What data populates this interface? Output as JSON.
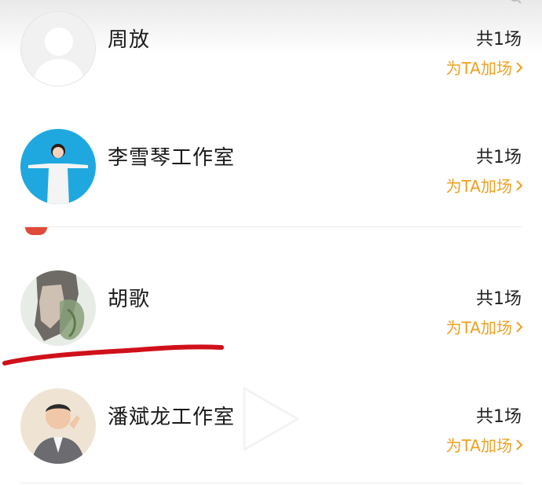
{
  "list": {
    "items": [
      {
        "name": "周放",
        "count": "共1场",
        "action": "为TA加场",
        "avatar": "default-avatar"
      },
      {
        "name": "李雪琴工作室",
        "count": "共1场",
        "action": "为TA加场",
        "avatar": "woman-white-outfit-blue-bg"
      },
      {
        "name": "胡歌",
        "count": "共1场",
        "action": "为TA加场",
        "avatar": "man-profile-double-exposure"
      },
      {
        "name": "潘斌龙工作室",
        "count": "共1场",
        "action": "为TA加场",
        "avatar": "man-grey-suit"
      }
    ]
  },
  "colors": {
    "accent": "#f0a020",
    "annotation": "#d0101a",
    "text": "#1a1a1a"
  },
  "icons": {
    "chevron": "chevron-right-icon",
    "play": "play-icon"
  }
}
